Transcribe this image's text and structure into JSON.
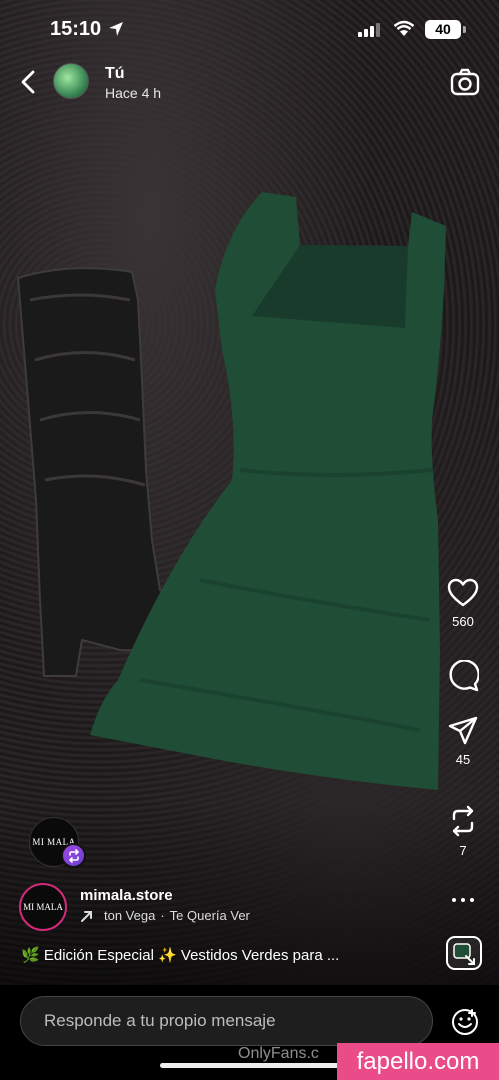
{
  "status_bar": {
    "time": "15:10",
    "battery": "40",
    "icons": [
      "location-arrow-icon",
      "signal-icon",
      "wifi-icon",
      "battery-icon"
    ]
  },
  "story_header": {
    "user_name": "Tú",
    "posted_ago": "Hace 4 h",
    "icons": [
      "back-chevron-icon",
      "camera-icon"
    ]
  },
  "actions": {
    "likes": "560",
    "shares": "45",
    "reposts": "7",
    "icons": [
      "heart-icon",
      "comment-icon",
      "send-icon",
      "repost-icon",
      "more-icon"
    ]
  },
  "brand_sticker": {
    "text": "MI MALA"
  },
  "shop": {
    "avatar_text": "MI MALA",
    "name": "mimala.store",
    "music": {
      "artist": "ton Vega",
      "separator": "·",
      "song": "Te Quería Ver"
    },
    "caption": "🌿 Edición Especial ✨ Vestidos Verdes para ..."
  },
  "reply": {
    "placeholder": "Responde a tu propio mensaje"
  },
  "watermarks": {
    "onlyfans": "OnlyFans.c",
    "site": "fapello.com"
  },
  "colors": {
    "accent_pink": "#ea4c89",
    "ring_pink": "#d22a7a",
    "repost_purple": "#7c44dc",
    "dress_green": "#1f4d36"
  }
}
